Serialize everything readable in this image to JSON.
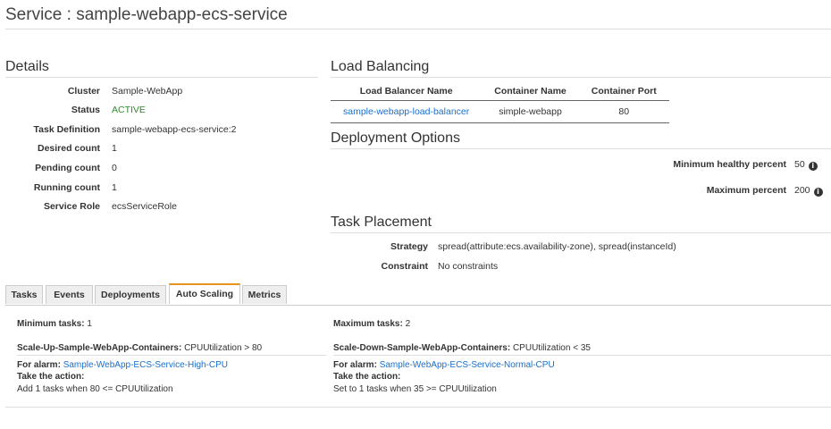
{
  "page": {
    "title": "Service : sample-webapp-ecs-service"
  },
  "details": {
    "title": "Details",
    "rows": [
      {
        "label": "Cluster",
        "value": "Sample-WebApp"
      },
      {
        "label": "Status",
        "value": "ACTIVE"
      },
      {
        "label": "Task Definition",
        "value": "sample-webapp-ecs-service:2"
      },
      {
        "label": "Desired count",
        "value": "1"
      },
      {
        "label": "Pending count",
        "value": "0"
      },
      {
        "label": "Running count",
        "value": "1"
      },
      {
        "label": "Service Role",
        "value": "ecsServiceRole"
      }
    ]
  },
  "load_balancing": {
    "title": "Load Balancing",
    "columns": [
      "Load Balancer Name",
      "Container Name",
      "Container Port"
    ],
    "row": {
      "lb_name": "sample-webapp-load-balancer",
      "container": "simple-webapp",
      "port": "80"
    }
  },
  "deployment": {
    "title": "Deployment Options",
    "min_label": "Minimum healthy percent",
    "min_value": "50",
    "max_label": "Maximum percent",
    "max_value": "200"
  },
  "placement": {
    "title": "Task Placement",
    "strategy_label": "Strategy",
    "strategy_value": "spread(attribute:ecs.availability-zone), spread(instanceId)",
    "constraint_label": "Constraint",
    "constraint_value": "No constraints"
  },
  "tabs": [
    "Tasks",
    "Events",
    "Deployments",
    "Auto Scaling",
    "Metrics"
  ],
  "selected_tab": "Auto Scaling",
  "autoscaling": {
    "min_label": "Minimum tasks:",
    "min_value": "1",
    "max_label": "Maximum tasks:",
    "max_value": "2",
    "up": {
      "name": "Scale-Up-Sample-WebApp-Containers:",
      "condition": "CPUUtilization > 80",
      "alarm_label": "For alarm:",
      "alarm": "Sample-WebApp-ECS-Service-High-CPU",
      "action_label": "Take the action:",
      "action": "Add 1 tasks when 80 <= CPUUtilization"
    },
    "down": {
      "name": "Scale-Down-Sample-WebApp-Containers:",
      "condition": "CPUUtilization < 35",
      "alarm_label": "For alarm:",
      "alarm": "Sample-WebApp-ECS-Service-Normal-CPU",
      "action_label": "Take the action:",
      "action": "Set to 1 tasks when 35 >= CPUUtilization"
    }
  },
  "colors": {
    "link": "#1a6fc9",
    "active": "#2b8a2b",
    "tab_accent": "#e8921f"
  },
  "icons": {
    "info": "info-icon"
  }
}
